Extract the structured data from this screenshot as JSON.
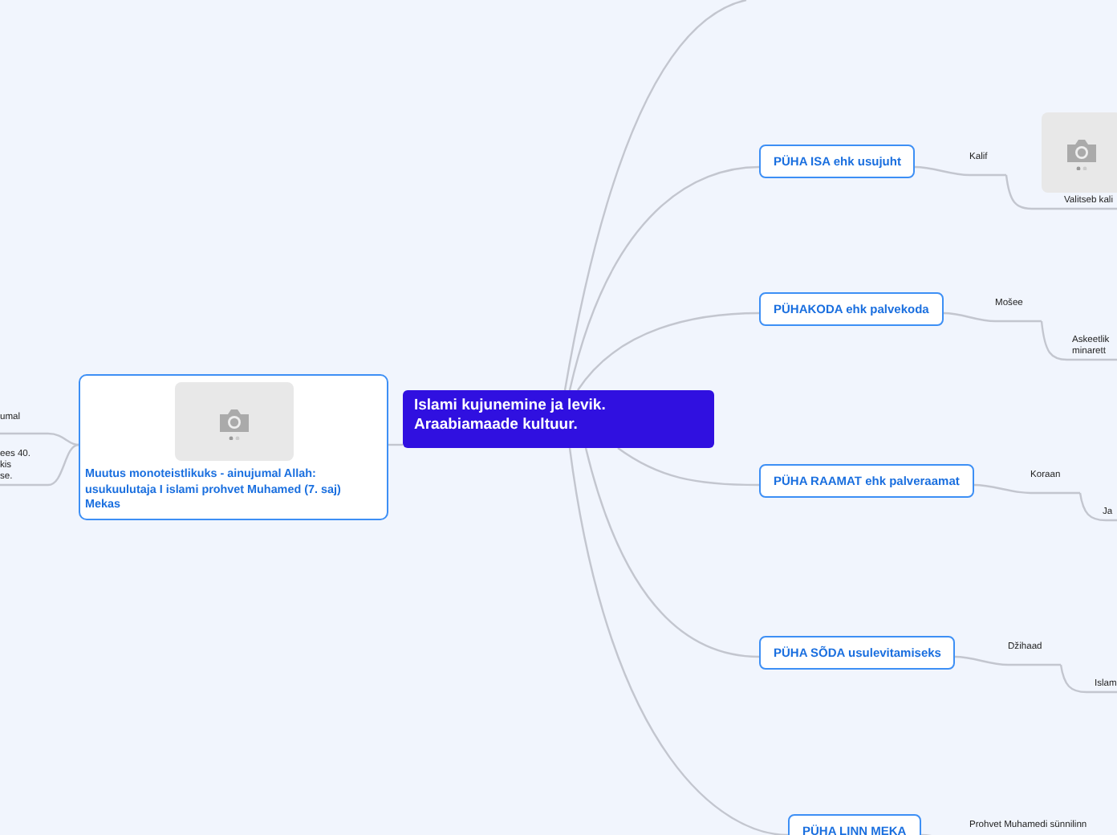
{
  "central_topic": "Islami kujunemine ja levik. Araabiamaade kultuur.",
  "left_topic": {
    "label": "Muutus monoteistlikuks - ainujumal Allah: usukuulutaja  I islami prohvet Muhamed (7. saj) Mekas",
    "has_image": true,
    "notes": [
      "umal",
      "ees 40.\nkis\nse."
    ]
  },
  "branches": [
    {
      "label": "PÜHA ISA ehk usujuht",
      "subtopic": "Kalif",
      "detail": "Valitseb kali",
      "detail_image": true
    },
    {
      "label": "PÜHAKODA ehk palvekoda",
      "subtopic": "Mošee",
      "detail": "Askeetlik\nminarett"
    },
    {
      "label": "PÜHA RAAMAT ehk palveraamat",
      "subtopic": "Koraan",
      "detail": "Ja"
    },
    {
      "label": "PÜHA SÕDA usulevitamiseks",
      "subtopic": "Džihaad",
      "detail": "Islam"
    },
    {
      "label": "PÜHA LINN MEKA",
      "subtopic": "Prohvet Muhamedi sünnilinn"
    }
  ]
}
